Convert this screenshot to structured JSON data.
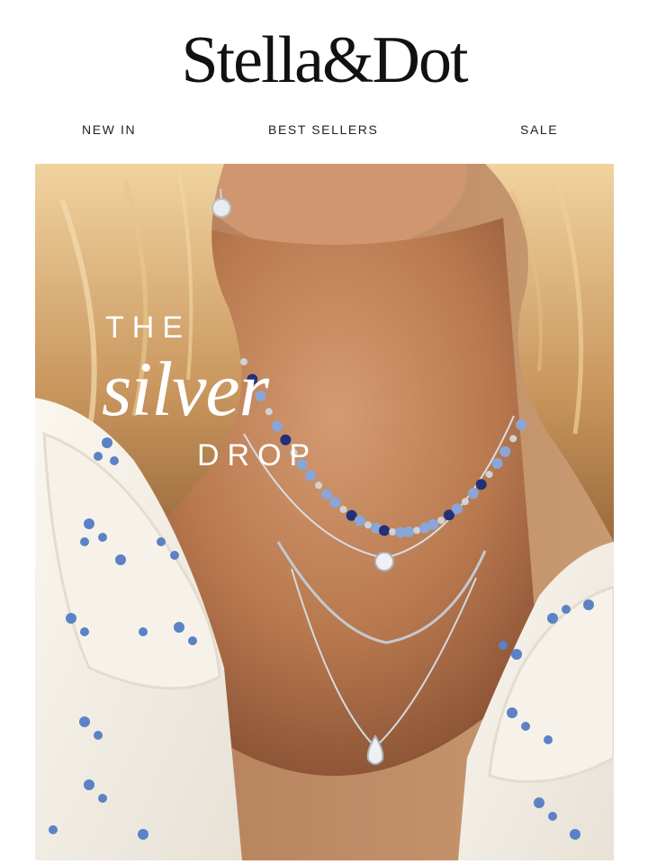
{
  "brand": {
    "logo_text": "Stella&Dot"
  },
  "nav": {
    "items": [
      "NEW IN",
      "BEST SELLERS",
      "SALE"
    ]
  },
  "hero": {
    "headline_top": "THE",
    "headline_script": "silver",
    "headline_bottom": "DROP"
  },
  "colors": {
    "background": "#ffffff",
    "text": "#1a1a1a",
    "hero_text": "#ffffff",
    "skin": "#c48a62",
    "hair": "#d9b482",
    "blouse": "#f3eee6",
    "embroidery": "#5b82c6",
    "beads_light": "#8aa6d8",
    "beads_dark": "#23307a",
    "silver": "#cfd3d8"
  }
}
